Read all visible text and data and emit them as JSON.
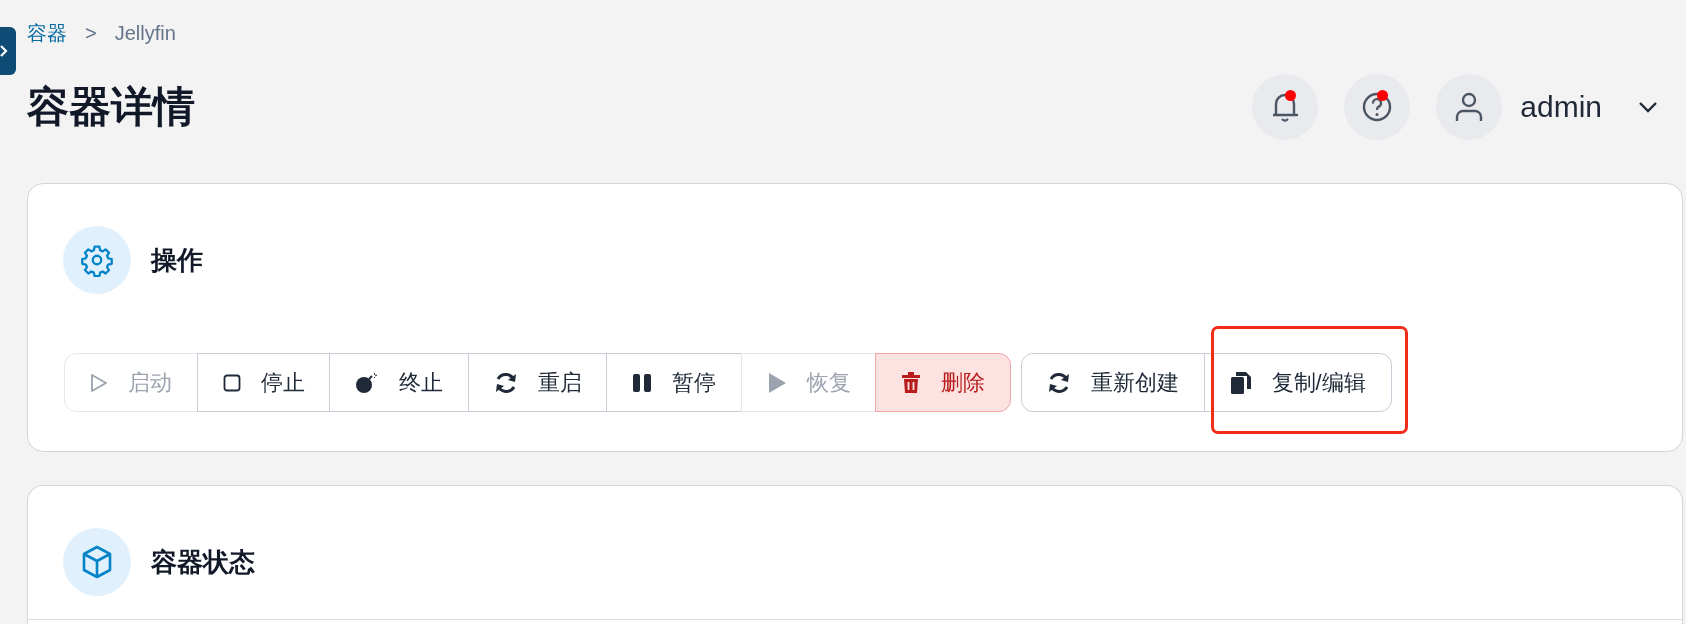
{
  "breadcrumb": [
    {
      "label": "容器",
      "link": true
    },
    {
      "label": ">",
      "link": false
    },
    {
      "label": "Jellyfin",
      "link": false
    }
  ],
  "page_title": "容器详情",
  "header": {
    "notifications": {
      "dot": true
    },
    "help": {
      "dot": true
    },
    "user": {
      "name": "admin"
    }
  },
  "actions_card": {
    "title": "操作",
    "groups": [
      [
        {
          "label": "启动",
          "disabled": true,
          "kind": "normal"
        },
        {
          "label": "停止",
          "disabled": false,
          "kind": "normal"
        },
        {
          "label": "终止",
          "disabled": false,
          "kind": "normal"
        },
        {
          "label": "重启",
          "disabled": false,
          "kind": "normal"
        },
        {
          "label": "暂停",
          "disabled": false,
          "kind": "normal"
        },
        {
          "label": "恢复",
          "disabled": true,
          "kind": "normal"
        },
        {
          "label": "删除",
          "disabled": false,
          "kind": "danger"
        }
      ],
      [
        {
          "label": "重新创建",
          "disabled": false,
          "kind": "normal",
          "highlighted": false
        },
        {
          "label": "复制/编辑",
          "disabled": false,
          "kind": "normal",
          "highlighted": true
        }
      ]
    ]
  },
  "status_card": {
    "title": "容器状态"
  }
}
